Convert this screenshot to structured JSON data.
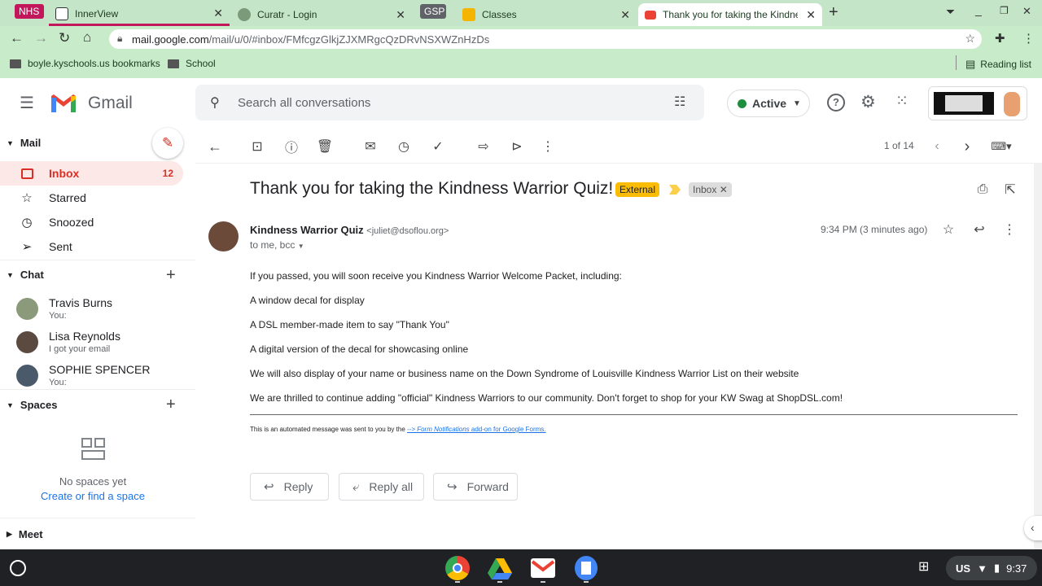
{
  "browser": {
    "tabs": [
      {
        "label": "NHS",
        "color": "#c2185b"
      },
      {
        "label": "InnerView"
      },
      {
        "label": "Curatr - Login"
      },
      {
        "label": "GSP"
      },
      {
        "label": "Classes"
      },
      {
        "label": "Thank you for taking the Kindne"
      }
    ],
    "url_host": "mail.google.com",
    "url_path": "/mail/u/0/#inbox/FMfcgzGlkjZJXMRgcQzDRvNSXWZnHzDs",
    "bookmarks": [
      "boyle.kyschools.us bookmarks",
      "School"
    ],
    "reading_list": "Reading list"
  },
  "gmail": {
    "logo_text": "Gmail",
    "search_placeholder": "Search all conversations",
    "status": "Active",
    "sidebar": {
      "mail_label": "Mail",
      "items": [
        {
          "label": "Inbox",
          "count": "12"
        },
        {
          "label": "Starred"
        },
        {
          "label": "Snoozed"
        },
        {
          "label": "Sent"
        }
      ],
      "chat_label": "Chat",
      "chats": [
        {
          "name": "Travis Burns",
          "sub": "You:"
        },
        {
          "name": "Lisa Reynolds",
          "sub": "I got your email"
        },
        {
          "name": "SOPHIE SPENCER",
          "sub": "You:"
        }
      ],
      "spaces_label": "Spaces",
      "no_spaces": "No spaces yet",
      "create_space": "Create or find a space",
      "meet_label": "Meet"
    },
    "pagination": "1 of 14",
    "email": {
      "subject": "Thank you for taking the Kindness Warrior Quiz!",
      "badge_external": "External",
      "badge_inbox": "Inbox",
      "sender_name": "Kindness Warrior Quiz",
      "sender_email": "<juliet@dsoflou.org>",
      "to": "to me, bcc",
      "time": "9:34 PM (3 minutes ago)",
      "lines": [
        "If you passed, you will soon receive you Kindness Warrior Welcome Packet, including:",
        "A window decal for display",
        "A DSL member-made item to say \"Thank You\"",
        "A digital version of the decal for showcasing online",
        "We will also display of your name or business name on the Down Syndrome of Louisville Kindness Warrior List on their website",
        "We are thrilled to continue adding \"official\" Kindness Warriors to our community. Don't forget to shop for your KW Swag at ShopDSL.com!"
      ],
      "footer_pre": "This is an automated message was sent to you by the ",
      "footer_link": "--> Form Notifications",
      "footer_post": " add-on for Google Forms."
    },
    "reply_buttons": [
      "Reply",
      "Reply all",
      "Forward"
    ]
  },
  "shelf": {
    "locale": "US",
    "time": "9:37"
  }
}
